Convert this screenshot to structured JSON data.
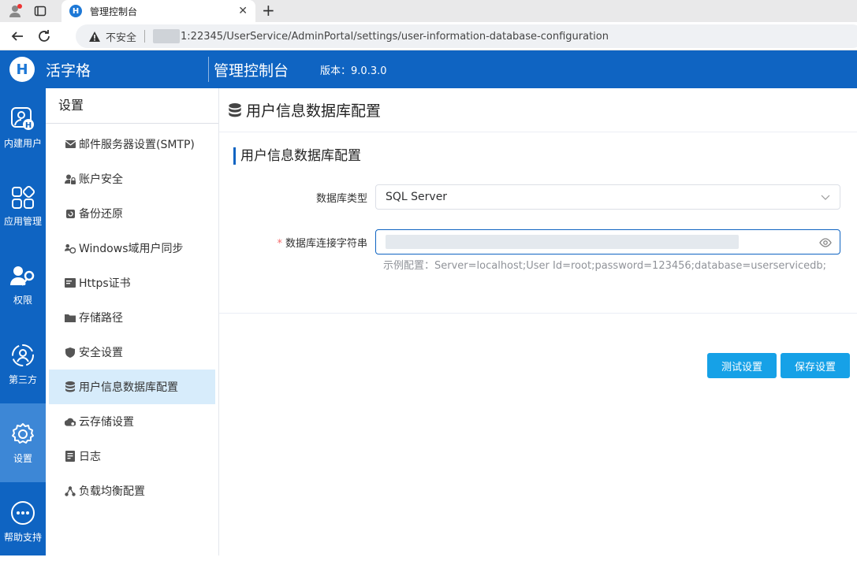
{
  "browser": {
    "tab_title": "管理控制台",
    "tab_favicon": "H",
    "security_label": "不安全",
    "url": "1:22345/UserService/AdminPortal/settings/user-information-database-configuration"
  },
  "header": {
    "logo_letter": "H",
    "brand": "活字格",
    "console_title": "管理控制台",
    "version": "版本：9.0.3.0"
  },
  "rail": {
    "items": [
      {
        "label": "内建用户",
        "icon": "user-h-icon"
      },
      {
        "label": "应用管理",
        "icon": "apps-grid-icon"
      },
      {
        "label": "权限",
        "icon": "user-key-icon"
      },
      {
        "label": "第三方",
        "icon": "user-circle-icon"
      },
      {
        "label": "设置",
        "icon": "gear-icon",
        "active": true
      },
      {
        "label": "帮助支持",
        "icon": "more-dots-icon"
      }
    ]
  },
  "menu": {
    "title": "设置",
    "items": [
      {
        "label": "邮件服务器设置(SMTP)",
        "icon": "mail-icon"
      },
      {
        "label": "账户安全",
        "icon": "user-lock-icon"
      },
      {
        "label": "备份还原",
        "icon": "backup-icon"
      },
      {
        "label": "Windows域用户同步",
        "icon": "users-sync-icon"
      },
      {
        "label": "Https证书",
        "icon": "certificate-icon"
      },
      {
        "label": "存储路径",
        "icon": "folder-icon"
      },
      {
        "label": "安全设置",
        "icon": "shield-icon"
      },
      {
        "label": "用户信息数据库配置",
        "icon": "database-icon",
        "active": true
      },
      {
        "label": "云存储设置",
        "icon": "cloud-icon"
      },
      {
        "label": "日志",
        "icon": "log-icon"
      },
      {
        "label": "负载均衡配置",
        "icon": "network-icon"
      }
    ]
  },
  "main": {
    "page_title": "用户信息数据库配置",
    "section_title": "用户信息数据库配置",
    "db_type_label": "数据库类型",
    "db_type_value": "SQL Server",
    "conn_label": "数据库连接字符串",
    "conn_required_mark": "*",
    "hint": "示例配置：Server=localhost;User Id=root;password=123456;database=userservicedb;",
    "test_button": "测试设置",
    "save_button": "保存设置"
  },
  "colors": {
    "primary": "#0f64c2",
    "button": "#16a1e7",
    "active_menu": "#d7ecfb"
  }
}
